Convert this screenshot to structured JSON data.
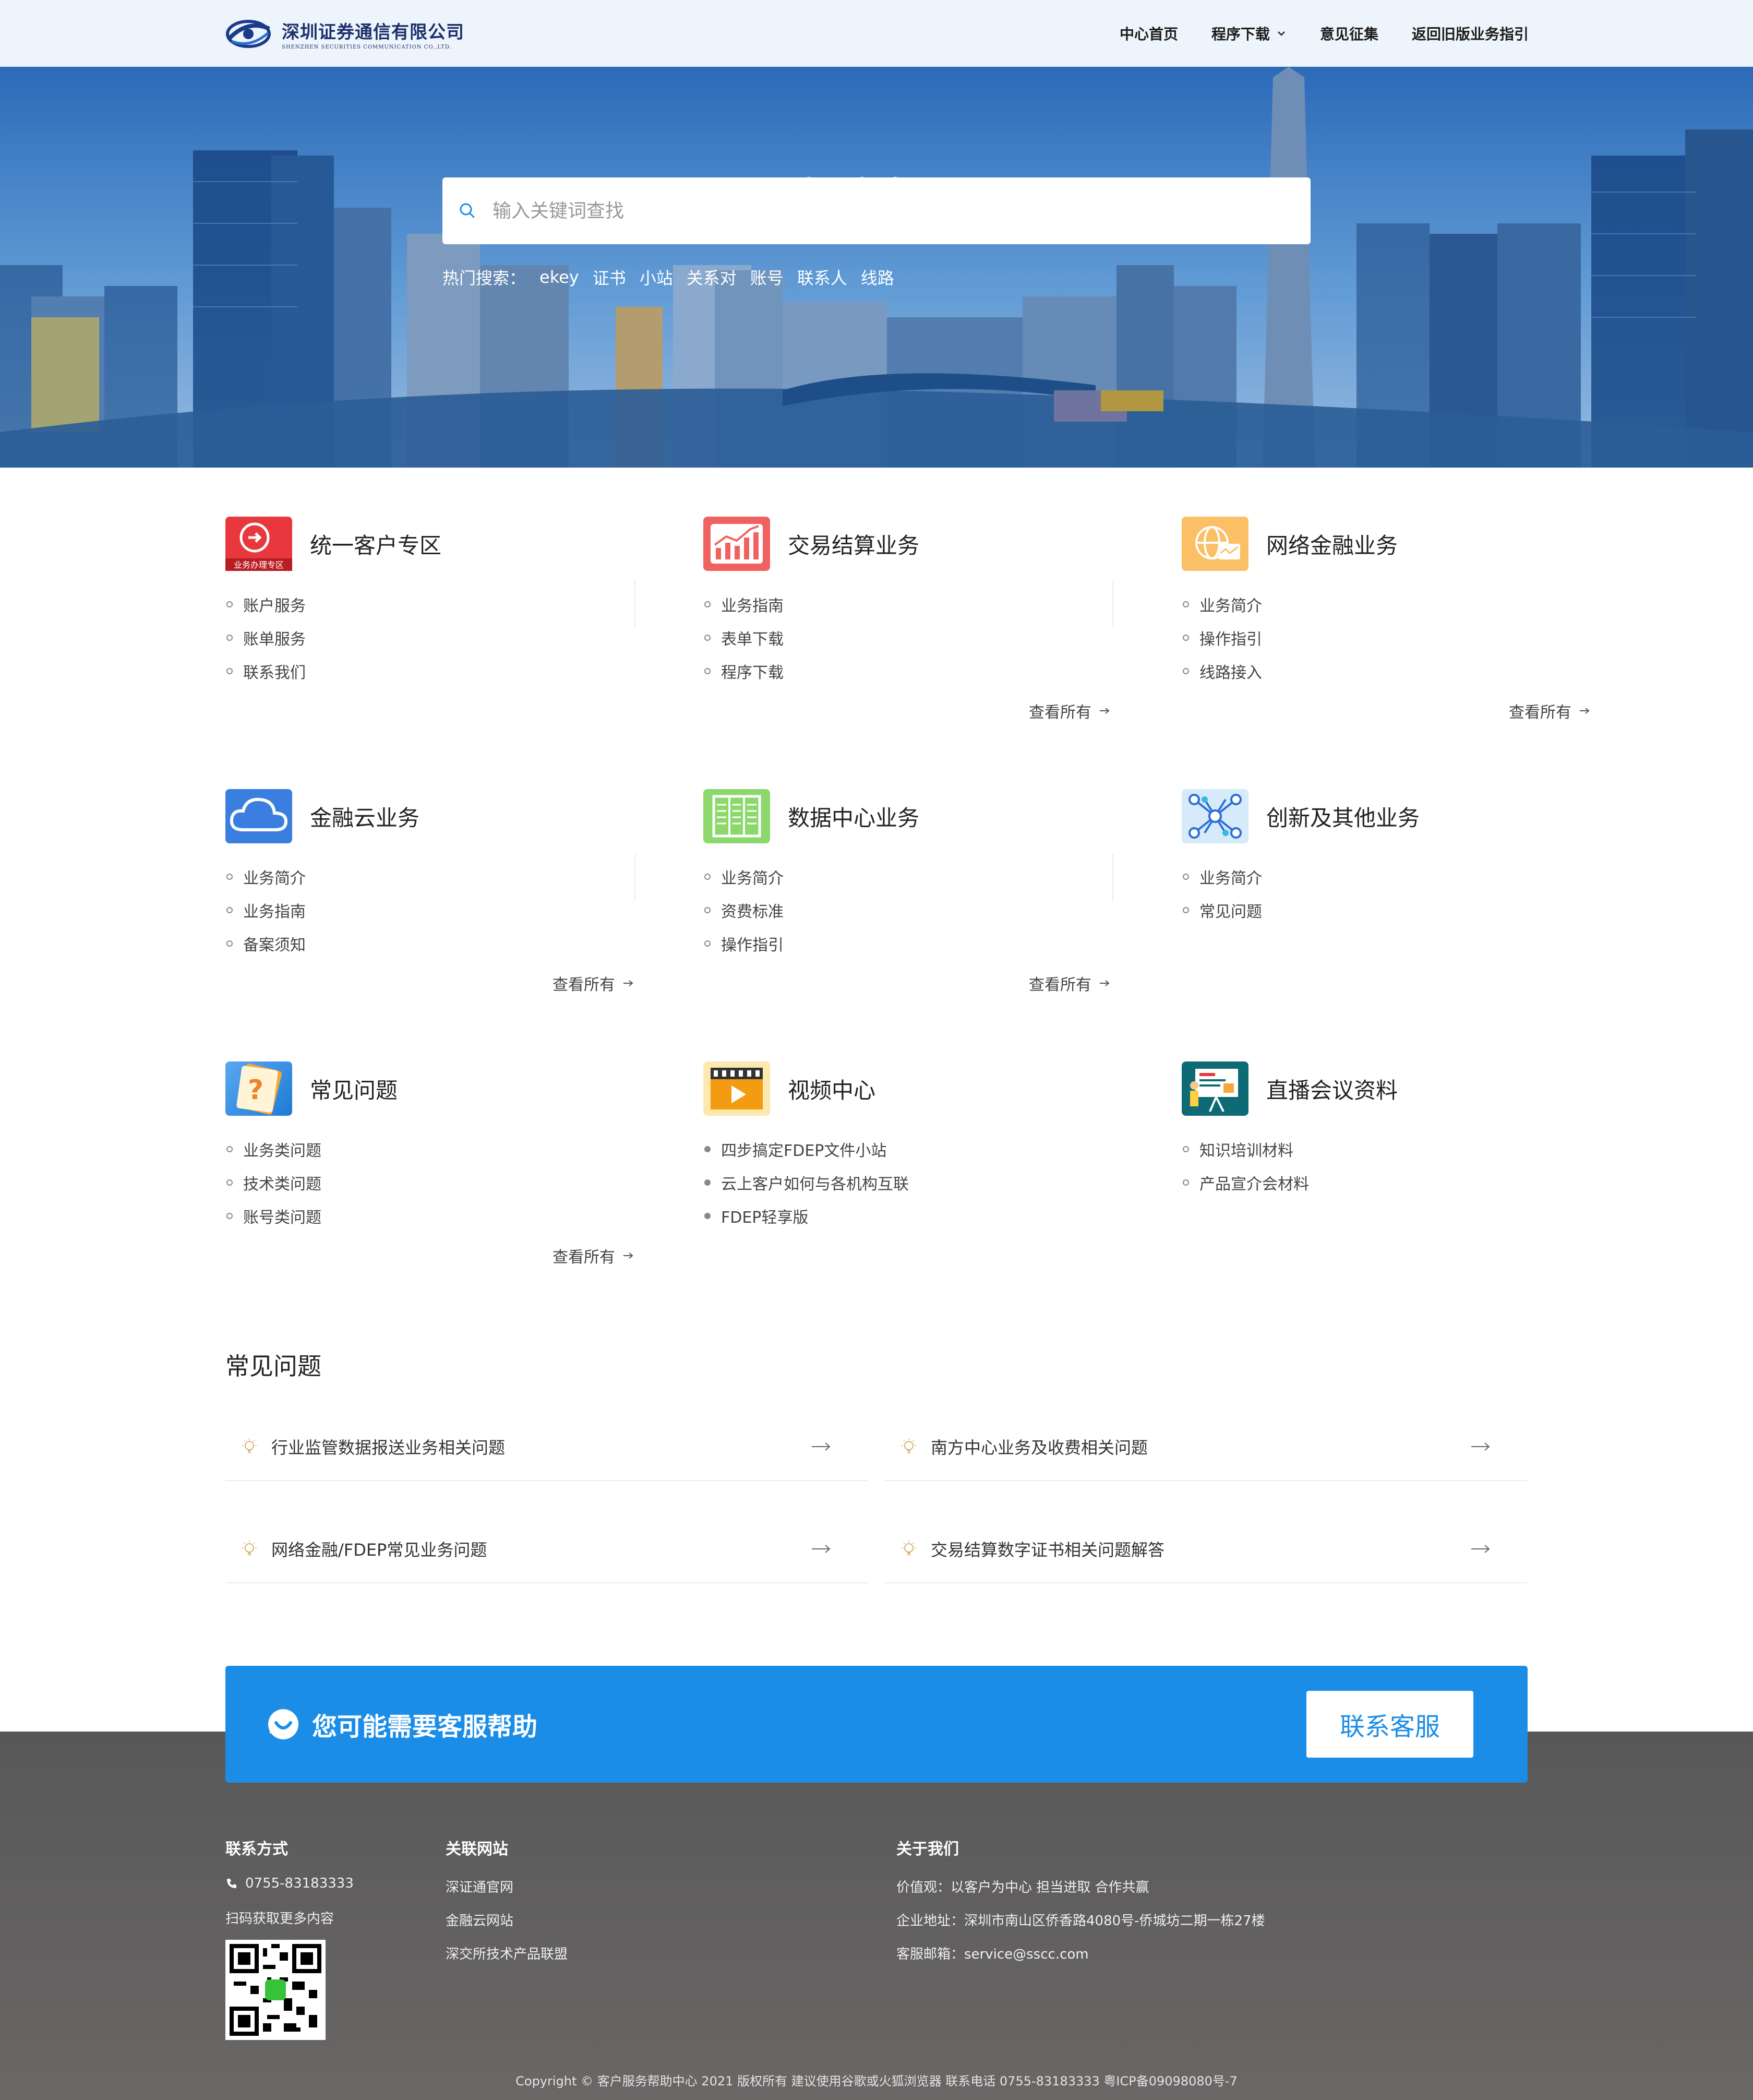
{
  "header": {
    "logo_cn": "深圳证券通信有限公司",
    "logo_en": "SHENZHEN SECURITIES COMMUNICATION CO.,LTD.",
    "nav": [
      {
        "label": "中心首页"
      },
      {
        "label": "程序下载"
      },
      {
        "label": "意见征集"
      },
      {
        "label": "返回旧版业务指引"
      }
    ]
  },
  "hero": {
    "title": "帮助中心",
    "search_placeholder": "输入关键词查找",
    "hot_label": "热门搜索：",
    "hot_tags": [
      "ekey",
      "证书",
      "小站",
      "关系对",
      "账号",
      "联系人",
      "线路"
    ]
  },
  "services": [
    {
      "title": "统一客户专区",
      "icon": "user-zone-icon",
      "icon_badge": "业务办理专区",
      "color": "#e8383d",
      "items": [
        "账户服务",
        "账单服务",
        "联系我们"
      ],
      "view_all": ""
    },
    {
      "title": "交易结算业务",
      "icon": "chart-up-icon",
      "color": "#f0625f",
      "items": [
        "业务指南",
        "表单下载",
        "程序下载"
      ],
      "view_all": "查看所有"
    },
    {
      "title": "网络金融业务",
      "icon": "globe-network-icon",
      "color": "#fbbf66",
      "items": [
        "业务简介",
        "操作指引",
        "线路接入"
      ],
      "view_all": "查看所有"
    },
    {
      "title": "金融云业务",
      "icon": "cloud-icon",
      "color": "#3a7fe0",
      "items": [
        "业务简介",
        "业务指南",
        "备案须知"
      ],
      "view_all": "查看所有"
    },
    {
      "title": "数据中心业务",
      "icon": "server-rack-icon",
      "color": "#8cd86c",
      "items": [
        "业务简介",
        "资费标准",
        "操作指引"
      ],
      "view_all": "查看所有"
    },
    {
      "title": "创新及其他业务",
      "icon": "network-nodes-icon",
      "color": "#cfe6f8",
      "items": [
        "业务简介",
        "常见问题"
      ],
      "view_all": ""
    },
    {
      "title": "常见问题",
      "icon": "question-note-icon",
      "color": "#5aa8f0",
      "items": [
        "业务类问题",
        "技术类问题",
        "账号类问题"
      ],
      "view_all": "查看所有"
    },
    {
      "title": "视频中心",
      "icon": "video-play-icon",
      "color": "#fde6a0",
      "items": [
        "四步搞定FDEP文件小站",
        "云上客户如何与各机构互联",
        "FDEP轻享版"
      ],
      "view_all": ""
    },
    {
      "title": "直播会议资料",
      "icon": "presentation-board-icon",
      "color": "#0e6b76",
      "items": [
        "知识培训材料",
        "产品宣介会材料"
      ],
      "view_all": ""
    }
  ],
  "faq": {
    "title": "常见问题",
    "items": [
      {
        "label": "行业监管数据报送业务相关问题"
      },
      {
        "label": "南方中心业务及收费相关问题"
      },
      {
        "label": "网络金融/FDEP常见业务问题"
      },
      {
        "label": "交易结算数字证书相关问题解答"
      }
    ]
  },
  "cta": {
    "text": "您可能需要客服帮助",
    "button": "联系客服"
  },
  "footer": {
    "contact_title": "联系方式",
    "phone": "0755-83183333",
    "qr_text": "扫码获取更多内容",
    "links_title": "关联网站",
    "links": [
      "深证通官网",
      "金融云网站",
      "深交所技术产品联盟"
    ],
    "about_title": "关于我们",
    "about": [
      "价值观：以客户为中心 担当进取 合作共赢",
      "企业地址：深圳市南山区侨香路4080号-侨城坊二期一栋27楼",
      "客服邮箱：service@sscc.com"
    ],
    "copyright": "Copyright © 客户服务帮助中心 2021 版权所有 建议使用谷歌或火狐浏览器 联系电话 0755-83183333 粤ICP备09098080号-7"
  },
  "colors": {
    "accent": "#1b8de6",
    "header_bg": "#eef4fb",
    "footer_bg": "#5e5c5b"
  }
}
